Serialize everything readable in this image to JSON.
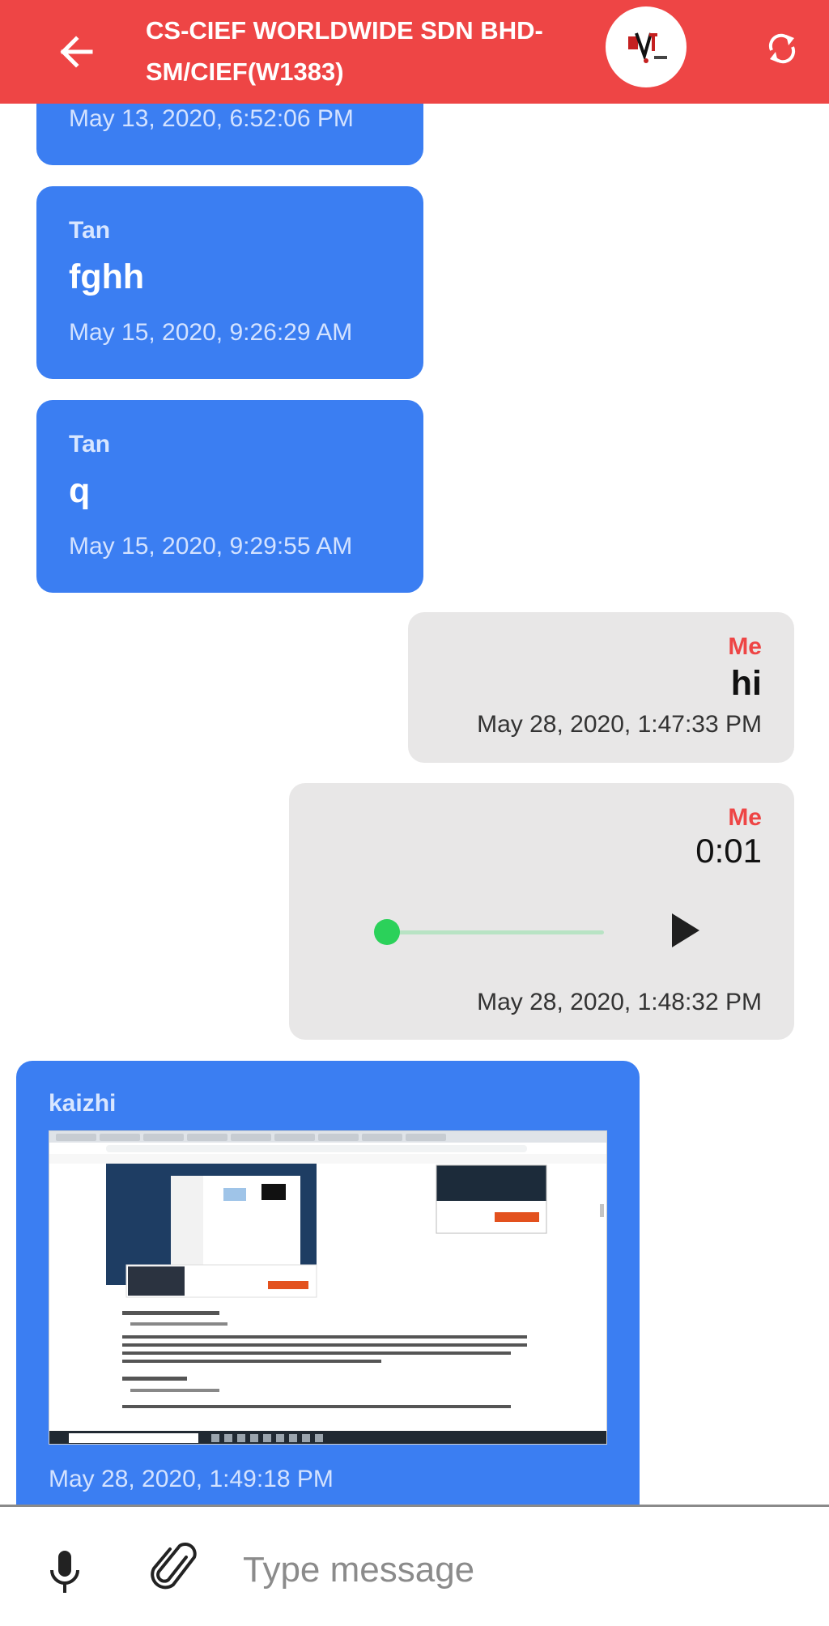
{
  "header": {
    "title": "CS-CIEF WORLDWIDE SDN BHD-SM/CIEF(W1383)",
    "back_icon": "arrow-left-icon",
    "refresh_icon": "refresh-icon",
    "logo_alt": "company-logo",
    "color": "#ee4545"
  },
  "messages": [
    {
      "type": "text",
      "side": "left",
      "timestamp": "May 13, 2020, 6:52:06 PM"
    },
    {
      "type": "text",
      "side": "left",
      "sender": "Tan",
      "text": "fghh",
      "timestamp": "May 15, 2020, 9:26:29 AM"
    },
    {
      "type": "text",
      "side": "left",
      "sender": "Tan",
      "text": "q",
      "timestamp": "May 15, 2020, 9:29:55 AM"
    },
    {
      "type": "text",
      "side": "right",
      "sender": "Me",
      "text": "hi",
      "timestamp": "May 28, 2020, 1:47:33 PM"
    },
    {
      "type": "audio",
      "side": "right",
      "sender": "Me",
      "duration": "0:01",
      "progress": 0,
      "timestamp": "May 28, 2020, 1:48:32 PM"
    },
    {
      "type": "image",
      "side": "left",
      "sender": "kaizhi",
      "image_icon": "screenshot-image",
      "timestamp": "May 28, 2020, 1:49:18 PM"
    }
  ],
  "composer": {
    "placeholder": "Type message",
    "mic_icon": "microphone-icon",
    "attach_icon": "paperclip-icon"
  },
  "colors": {
    "incoming_bubble": "#3b7ef2",
    "outgoing_bubble": "#e8e7e7",
    "sender_me": "#ee4545",
    "audio_progress": "#2bd15a"
  }
}
